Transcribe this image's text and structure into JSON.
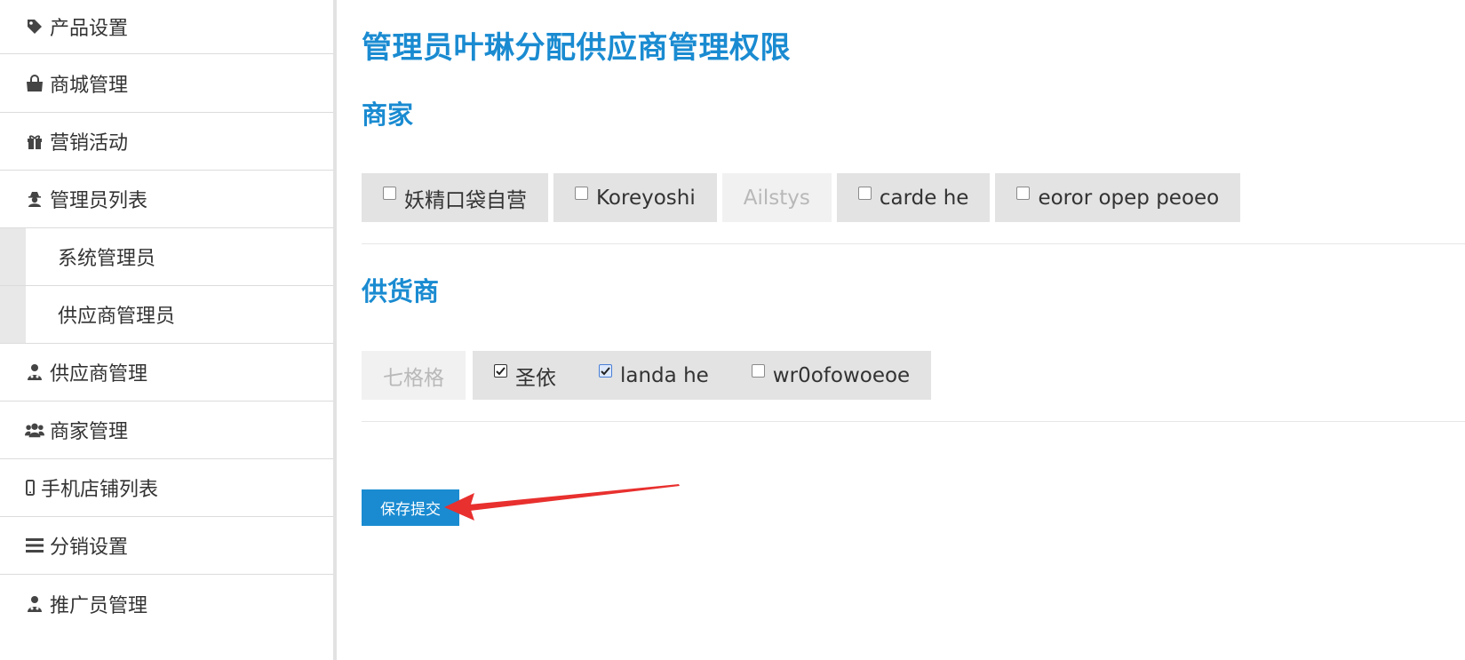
{
  "sidebar": {
    "items": [
      {
        "label": "产品设置",
        "icon": "tag-icon"
      },
      {
        "label": "商城管理",
        "icon": "shopping-bag-icon"
      },
      {
        "label": "营销活动",
        "icon": "gift-icon"
      },
      {
        "label": "管理员列表",
        "icon": "user-secret-icon"
      },
      {
        "label": "系统管理员"
      },
      {
        "label": "供应商管理员"
      },
      {
        "label": "供应商管理",
        "icon": "user-md-icon"
      },
      {
        "label": "商家管理",
        "icon": "users-icon"
      },
      {
        "label": "手机店铺列表",
        "icon": "mobile-icon"
      },
      {
        "label": "分销设置",
        "icon": "bars-icon"
      },
      {
        "label": "推广员管理",
        "icon": "user-md-icon"
      }
    ]
  },
  "main": {
    "title": "管理员叶琳分配供应商管理权限",
    "merchant_section": {
      "title": "商家",
      "options": [
        {
          "label": "妖精口袋自营",
          "checked": false,
          "disabled": false
        },
        {
          "label": "Koreyoshi",
          "checked": false,
          "disabled": false
        },
        {
          "label": "Ailstys",
          "checked": false,
          "disabled": true
        },
        {
          "label": "carde he",
          "checked": false,
          "disabled": false
        },
        {
          "label": "eoror opep peoeo",
          "checked": false,
          "disabled": false
        }
      ]
    },
    "supplier_section": {
      "title": "供货商",
      "options": [
        {
          "label": "七格格",
          "checked": false,
          "disabled": true
        },
        {
          "label": "圣依",
          "checked": true,
          "disabled": false
        },
        {
          "label": "landa he",
          "checked": true,
          "disabled": false
        },
        {
          "label": "wr0ofowoeoe",
          "checked": false,
          "disabled": false
        }
      ]
    },
    "submit_label": "保存提交"
  },
  "colors": {
    "accent": "#1a8bd1",
    "chip_bg": "#e3e3e3",
    "chip_disabled_bg": "#f1f1f1",
    "annotation_arrow": "#e8302e"
  }
}
